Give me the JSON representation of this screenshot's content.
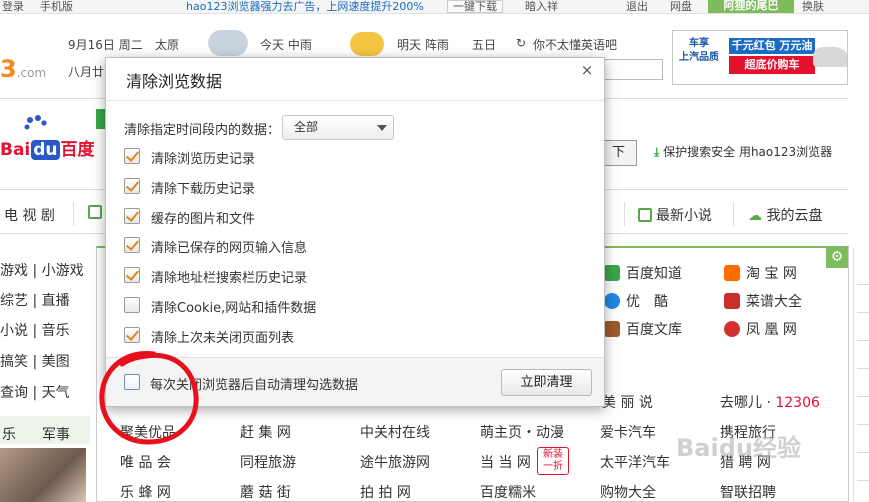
{
  "topbar": {
    "left1": "登录",
    "left2": "手机版",
    "promo": "hao123浏览器强力去广告，上网速度提升200%",
    "download_button": "一键下载",
    "recommend": "暗入祥",
    "exit": "退出",
    "pan": "网盘",
    "user": "阿狸的尾巴",
    "skin": "换肤"
  },
  "header": {
    "logo_suffix": ".com",
    "date": "9月16日 周二",
    "city": "太原",
    "today": "今天 中雨",
    "tomorrow": "明天 阵雨",
    "day5": "五日",
    "refresh_text": "你不太懂英语吧",
    "lunar": "八月廿"
  },
  "ad": {
    "brand": "车享",
    "brand_sub": "上汽品质",
    "line1": "千元红包 万元油卡",
    "line2": "超底价购车"
  },
  "search": {
    "baidu_prefix": "Bai",
    "baidu_du": "du",
    "baidu_suffix": "百度",
    "button": "下",
    "secure_link": "保护搜索安全 用hao123浏览器"
  },
  "nav": {
    "tv": "电 视 剧",
    "novel": "最新小说",
    "cloud": "我的云盘"
  },
  "left_links": [
    {
      "a": "游戏",
      "b": "小游戏"
    },
    {
      "a": "综艺",
      "b": "直播"
    },
    {
      "a": "小说",
      "b": "音乐"
    },
    {
      "a": "搞笑",
      "b": "美图"
    },
    {
      "a": "查询",
      "b": "天气"
    }
  ],
  "left_strip": {
    "a": "乐",
    "b": "军事"
  },
  "sites": {
    "baidu_zhidao": "百度知道",
    "taobao": "淘 宝 网",
    "youku": "优　酷",
    "caipu": "菜谱大全",
    "wenku": "百度文库",
    "ifeng": "凤 凰 网",
    "meilishuo": "美 丽 说",
    "qunar": "去哪儿",
    "qunar_phone": "12306",
    "jumei": "聚美优品",
    "ganji": "赶 集 网",
    "zol": "中关村在线",
    "mengzhuye": "萌主页・动漫",
    "aika": "爱卡汽车",
    "xiecheng": "携程旅行",
    "vip": "唯 品 会",
    "tongcheng": "同程旅游",
    "tuniu": "途牛旅游网",
    "dangdang": "当 当 网",
    "pcauto": "太平洋汽车",
    "lietou": "猎 聘 网",
    "lefeng": "乐 蜂 网",
    "mogu": "蘑 菇 街",
    "paipai": "拍 拍 网",
    "nuomi": "百度糯米",
    "gouwu": "购物大全",
    "zhilian": "智联招聘"
  },
  "new_badge": {
    "line1": "新装",
    "line2": "一折"
  },
  "watermark": "Baidu经验",
  "dialog": {
    "title": "清除浏览数据",
    "close_glyph": "×",
    "range_label": "清除指定时间段内的数据：",
    "range_value": "全部",
    "options": [
      {
        "label": "清除浏览历史记录",
        "checked": true
      },
      {
        "label": "清除下载历史记录",
        "checked": true
      },
      {
        "label": "缓存的图片和文件",
        "checked": true
      },
      {
        "label": "清除已保存的网页输入信息",
        "checked": true
      },
      {
        "label": "清除地址栏搜索栏历史记录",
        "checked": true
      },
      {
        "label": "清除Cookie,网站和插件数据",
        "checked": false
      },
      {
        "label": "清除上次未关闭页面列表",
        "checked": true
      }
    ],
    "auto_clear_label": "每次关闭浏览器后自动清理勾选数据",
    "auto_clear_checked": false,
    "clear_button": "立即清理"
  },
  "colors": {
    "accent_green": "#7dbb5b",
    "check_orange": "#e0861a",
    "annotation_red": "#e8101c"
  }
}
